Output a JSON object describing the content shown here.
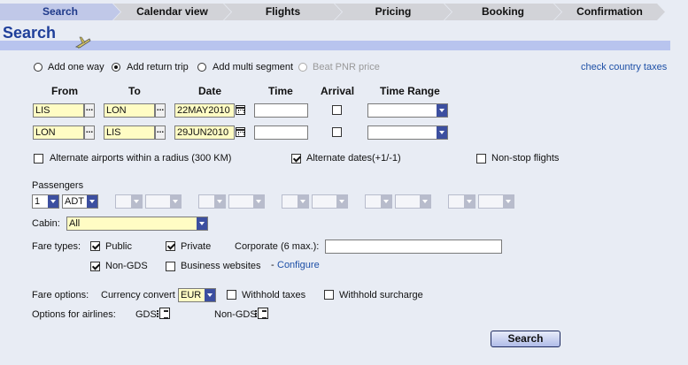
{
  "steps": [
    "Search",
    "Calendar view",
    "Flights",
    "Pricing",
    "Booking",
    "Confirmation"
  ],
  "page_title": "Search",
  "trip_options": {
    "add_one_way": "Add one way",
    "add_return_trip": "Add return trip",
    "add_multi_segment": "Add multi segment",
    "beat_pnr": "Beat PNR price",
    "selected": "Add return trip"
  },
  "check_country_taxes": "check country taxes",
  "columns": {
    "from": "From",
    "to": "To",
    "date": "Date",
    "time": "Time",
    "arrival": "Arrival",
    "time_range": "Time Range"
  },
  "segments": [
    {
      "from": "LIS",
      "to": "LON",
      "date": "22MAY2010",
      "time": "",
      "arrival": false,
      "time_range": ""
    },
    {
      "from": "LON",
      "to": "LIS",
      "date": "29JUN2010",
      "time": "",
      "arrival": false,
      "time_range": ""
    }
  ],
  "search_options": {
    "alternate_airports": {
      "label": "Alternate airports within a radius (300 KM)",
      "checked": false
    },
    "alternate_dates": {
      "label": "Alternate dates(+1/-1)",
      "checked": true
    },
    "non_stop": {
      "label": "Non-stop flights",
      "checked": false
    }
  },
  "passengers": {
    "label": "Passengers",
    "count": "1",
    "type": "ADT"
  },
  "cabin": {
    "label": "Cabin:",
    "value": "All"
  },
  "fare_types": {
    "label": "Fare types:",
    "public": {
      "label": "Public",
      "checked": true
    },
    "private": {
      "label": "Private",
      "checked": true
    },
    "corporate_label": "Corporate (6 max.):",
    "corporate_value": "",
    "non_gds": {
      "label": "Non-GDS",
      "checked": true
    },
    "business_websites": {
      "label": "Business websites",
      "checked": false
    },
    "configure_prefix": "-",
    "configure": "Configure"
  },
  "fare_options": {
    "label": "Fare options:",
    "currency_label": "Currency convert",
    "currency": "EUR",
    "withhold_taxes": {
      "label": "Withhold taxes",
      "checked": false
    },
    "withhold_surcharge": {
      "label": "Withhold surcharge",
      "checked": false
    }
  },
  "airline_options": {
    "label": "Options for airlines:",
    "gds": "GDS",
    "non_gds": "Non-GDS"
  },
  "search_button": "Search",
  "colors": {
    "accent": "#1f3f9a",
    "tab_active": "#c0c8e8",
    "field_yellow": "#fffcc4",
    "dropdown_arrow": "#3c4fa0"
  }
}
